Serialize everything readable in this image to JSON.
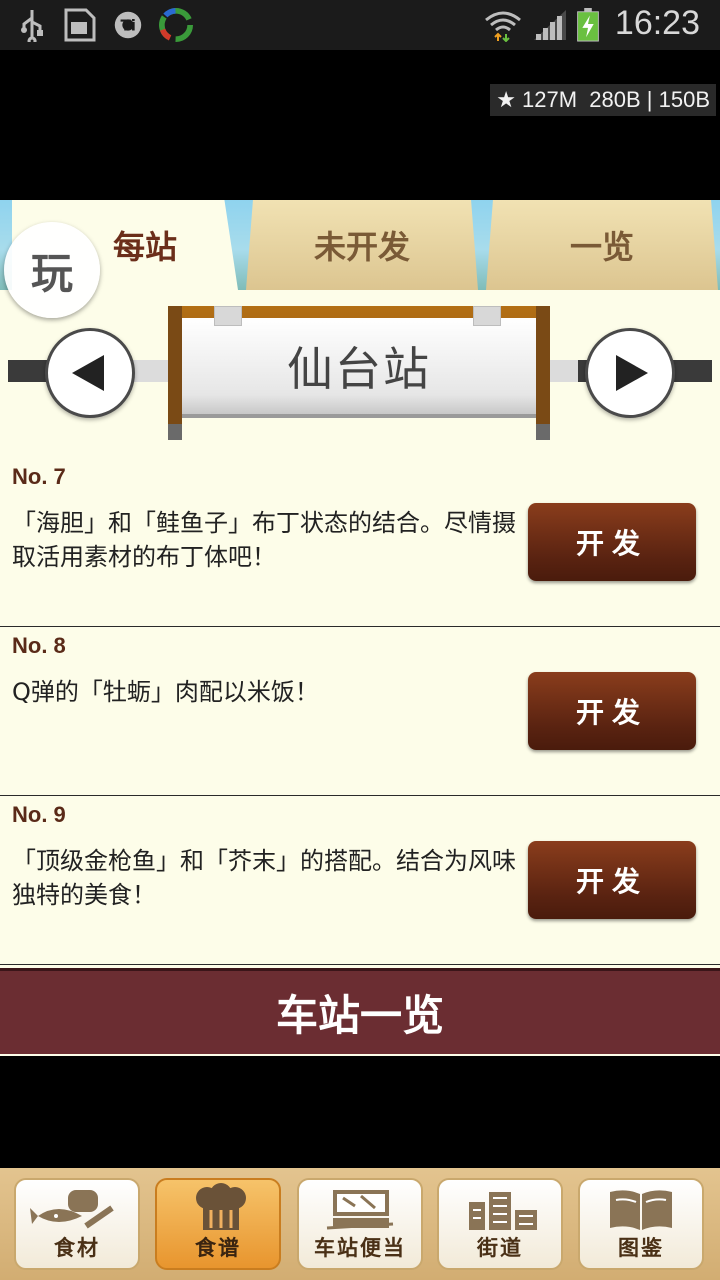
{
  "status_bar": {
    "icons": [
      "usb-icon",
      "sd-card-icon",
      "settings-app-icon",
      "sync-app-icon",
      "wifi-icon",
      "signal-icon",
      "battery-charging-icon"
    ],
    "time": "16:23"
  },
  "overlay_stats": "★ 127M  280B | 150B",
  "tabs": [
    {
      "label": "每站",
      "active": true
    },
    {
      "label": "未开发",
      "active": false
    },
    {
      "label": "一览",
      "active": false
    }
  ],
  "play_badge": "玩",
  "station": {
    "name": "仙台站"
  },
  "recipes": [
    {
      "no": "No. 7",
      "desc": "「海胆」和「鲑鱼子」布丁状态的结合。尽情摄取活用素材的布丁体吧！",
      "button": "开发"
    },
    {
      "no": "No. 8",
      "desc": "Q弹的「牡蛎」肉配以米饭！",
      "button": "开发"
    },
    {
      "no": "No. 9",
      "desc": "「顶级金枪鱼」和「芥末」的搭配。结合为风味独特的美食！",
      "button": "开发"
    }
  ],
  "station_list_button": "车站一览",
  "bottom_nav": [
    {
      "label": "食材",
      "icon": "ingredients-icon",
      "active": false
    },
    {
      "label": "食谱",
      "icon": "chef-hat-icon",
      "active": true
    },
    {
      "label": "车站便当",
      "icon": "bento-box-icon",
      "active": false
    },
    {
      "label": "街道",
      "icon": "buildings-icon",
      "active": false
    },
    {
      "label": "图鉴",
      "icon": "book-icon",
      "active": false
    }
  ],
  "colors": {
    "app_bg": "#fdfde9",
    "accent_brown": "#5a2311",
    "station_bar": "#6b2d32",
    "nav_active": "#e8952e"
  }
}
